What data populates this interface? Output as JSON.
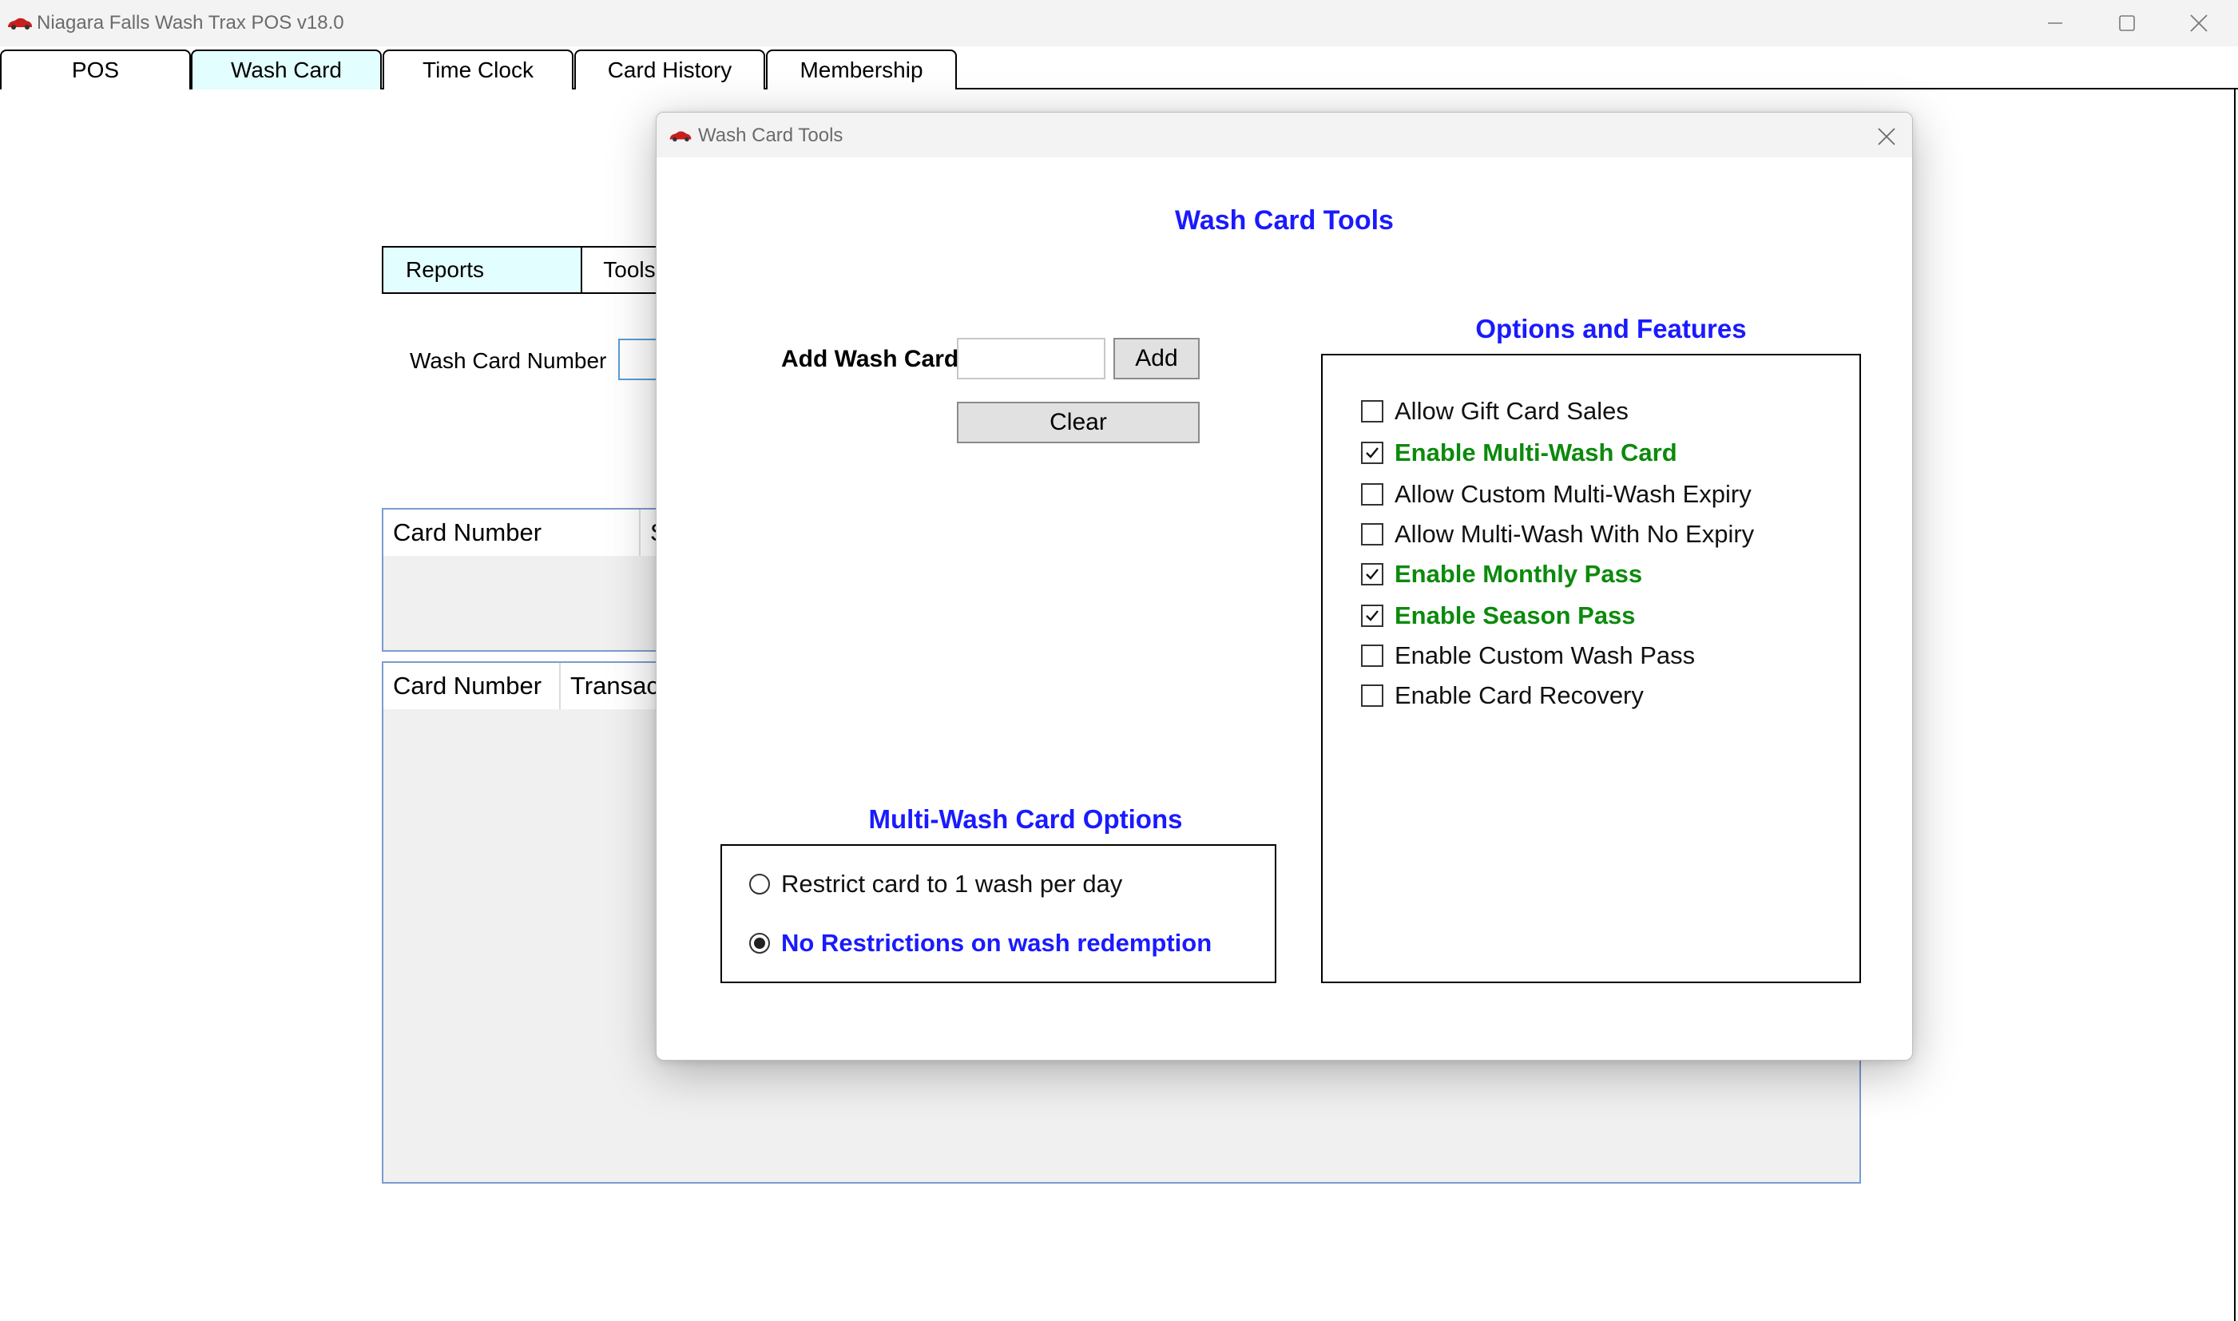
{
  "window": {
    "title": "Niagara Falls Wash Trax POS v18.0",
    "icon": "red-car-icon"
  },
  "main_tabs": [
    {
      "label": "POS",
      "active": false
    },
    {
      "label": "Wash Card",
      "active": true
    },
    {
      "label": "Time Clock",
      "active": false
    },
    {
      "label": "Card History",
      "active": false
    },
    {
      "label": "Membership",
      "active": false
    }
  ],
  "wash_card_page": {
    "subtabs": {
      "reports": "Reports",
      "tools": "Tools"
    },
    "card_number_label": "Wash Card Number",
    "card_number_value": "",
    "grid1_columns": [
      "Card Number",
      "S"
    ],
    "grid2_columns": [
      "Card Number",
      "Transact"
    ]
  },
  "dialog": {
    "title": "Wash Card Tools",
    "heading": "Wash Card Tools",
    "add_card_label": "Add Wash Card",
    "add_card_value": "",
    "add_button": "Add",
    "clear_button": "Clear",
    "options_title": "Options and Features",
    "options": [
      {
        "label": "Allow Gift Card Sales",
        "checked": false
      },
      {
        "label": "Enable Multi-Wash Card",
        "checked": true
      },
      {
        "label": "Allow Custom Multi-Wash Expiry",
        "checked": false
      },
      {
        "label": "Allow Multi-Wash With No Expiry",
        "checked": false
      },
      {
        "label": "Enable Monthly Pass",
        "checked": true
      },
      {
        "label": "Enable Season Pass",
        "checked": true
      },
      {
        "label": "Enable Custom Wash Pass",
        "checked": false
      },
      {
        "label": "Enable Card Recovery",
        "checked": false
      }
    ],
    "multi_wash_title": "Multi-Wash Card Options",
    "multi_wash_options": [
      {
        "label": "Restrict card to 1 wash per day",
        "selected": false
      },
      {
        "label": "No Restrictions on wash redemption",
        "selected": true
      }
    ]
  },
  "colors": {
    "active_tab": "#e3feff",
    "heading_blue": "#1a1aff",
    "enabled_green": "#0c8a0c"
  }
}
